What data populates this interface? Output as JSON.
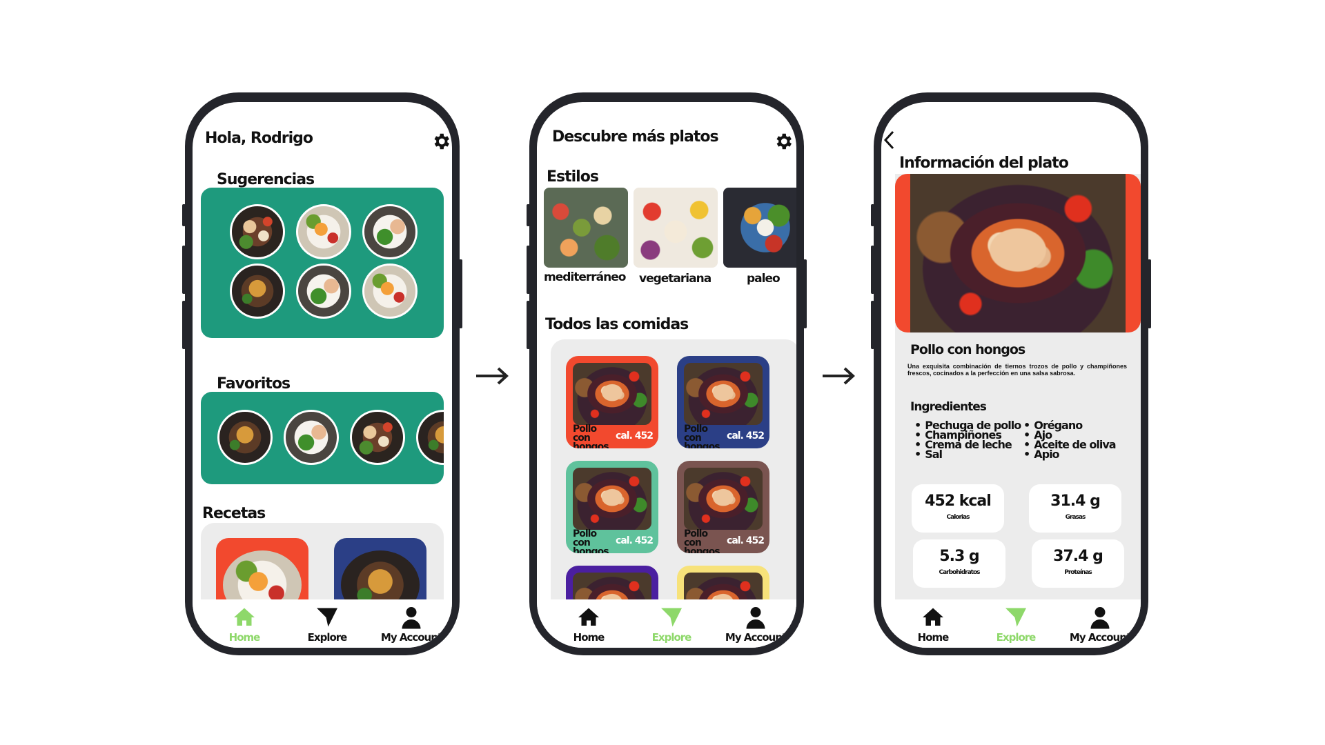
{
  "screen1": {
    "greeting": "Hola, Rodrigo",
    "section_suggestions": "Sugerencias",
    "section_favorites": "Favoritos",
    "section_recipes": "Recetas"
  },
  "screen2": {
    "title": "Descubre más platos",
    "section_styles": "Estilos",
    "styles": [
      "mediterráneo",
      "vegetariana",
      "paleo"
    ],
    "section_all": "Todos las comidas",
    "meals": [
      {
        "name": "Pollo con hongos",
        "cal": "cal. 452",
        "color": "#f2492e"
      },
      {
        "name": "Pollo con hongos",
        "cal": "cal. 452",
        "color": "#2b3f86"
      },
      {
        "name": "Pollo con hongos",
        "cal": "cal. 452",
        "color": "#5fc29c"
      },
      {
        "name": "Pollo con hongos",
        "cal": "cal. 452",
        "color": "#7a5450"
      }
    ]
  },
  "screen3": {
    "title": "Información del plato",
    "dish_name": "Pollo con hongos",
    "description": "Una exquisita combinación de tiernos trozos de pollo y champiñones frescos, cocinados a la perfección en una salsa sabrosa.",
    "ingredients_title": "Ingredientes",
    "ingredients_left": [
      "Pechuga de pollo",
      "Champiñones",
      "Crema de leche",
      "Sal"
    ],
    "ingredients_right": [
      "Orégano",
      "Ajo",
      "Aceite de oliva",
      "Apio"
    ],
    "nutrition": [
      {
        "value": "452 kcal",
        "label": "Calorias"
      },
      {
        "value": "31.4 g",
        "label": "Grasas"
      },
      {
        "value": "5.3 g",
        "label": "Carbohidratos"
      },
      {
        "value": "37.4 g",
        "label": "Proteínas"
      }
    ]
  },
  "nav": {
    "home": "Home",
    "explore": "Explore",
    "account": "My Account"
  },
  "colors": {
    "teal": "#1e9a7d",
    "active_nav": "#8ed86a",
    "hero_bg": "#f2492e",
    "recipe_red": "#f2492e",
    "recipe_blue": "#2b3f86",
    "purple": "#4b1fa0",
    "yellow": "#f7e27a"
  },
  "icons": [
    "gear-icon",
    "home-icon",
    "explore-icon",
    "account-icon",
    "back-arrow-icon",
    "right-arrow-icon"
  ]
}
